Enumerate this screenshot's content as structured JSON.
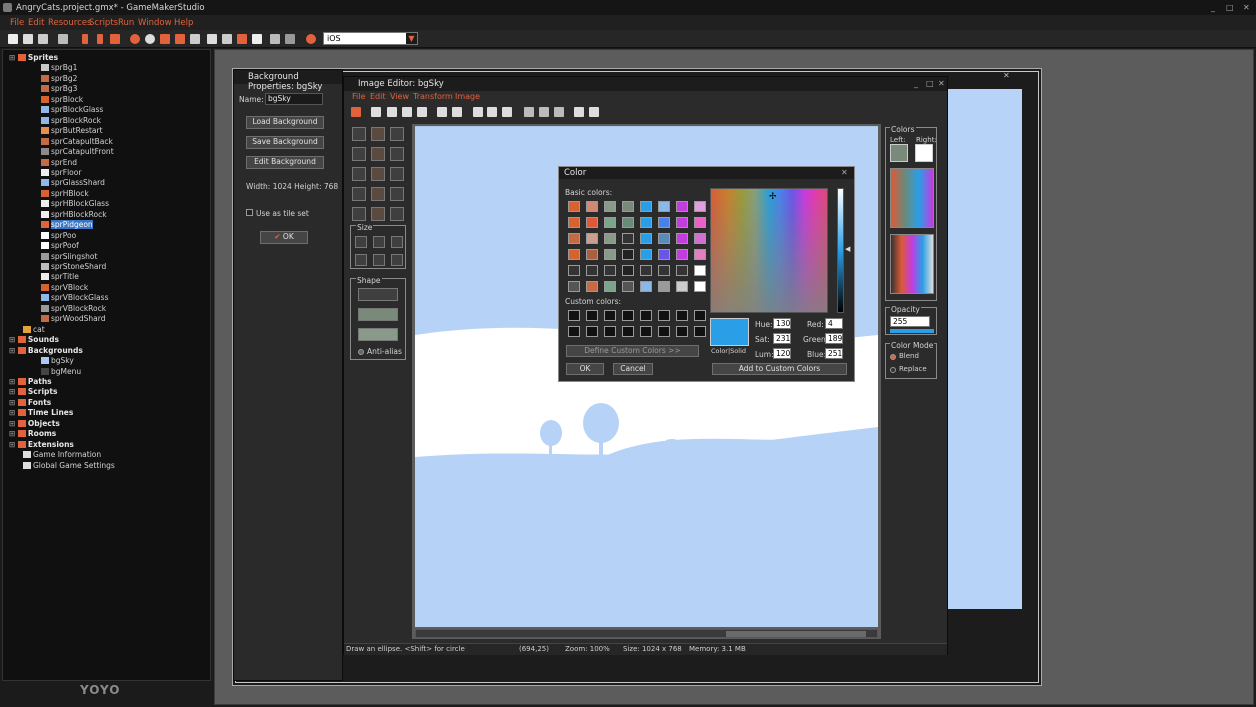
{
  "app": {
    "title": "AngryCats.project.gmx* - GameMakerStudio"
  },
  "menu": [
    "File",
    "Edit",
    "Resources",
    "Scripts",
    "Run",
    "Window",
    "Help"
  ],
  "toolbar": {
    "target": "iOS"
  },
  "tree": {
    "items": [
      {
        "label": "Sprites",
        "level": 0,
        "group": true
      },
      {
        "label": "sprBg1",
        "level": 2,
        "icon": "#c8c8c8"
      },
      {
        "label": "sprBg2",
        "level": 2,
        "icon": "#c46a44"
      },
      {
        "label": "sprBg3",
        "level": 2,
        "icon": "#c46a44"
      },
      {
        "label": "sprBlock",
        "level": 2,
        "icon": "#d5622f"
      },
      {
        "label": "sprBlockGlass",
        "level": 2,
        "icon": "#8fb8e8"
      },
      {
        "label": "sprBlockRock",
        "level": 2,
        "icon": "#8fb8e8"
      },
      {
        "label": "sprButRestart",
        "level": 2,
        "icon": "#e09050"
      },
      {
        "label": "sprCatapultBack",
        "level": 2,
        "icon": "#c46a44"
      },
      {
        "label": "sprCatapultFront",
        "level": 2,
        "icon": "#8a8a8a"
      },
      {
        "label": "sprEnd",
        "level": 2,
        "icon": "#c46a44"
      },
      {
        "label": "sprFloor",
        "level": 2,
        "icon": "#eeeeee"
      },
      {
        "label": "sprGlassShard",
        "level": 2,
        "icon": "#8fb8e8"
      },
      {
        "label": "sprHBlock",
        "level": 2,
        "icon": "#d5622f"
      },
      {
        "label": "sprHBlockGlass",
        "level": 2,
        "icon": "#eeeeee"
      },
      {
        "label": "sprHBlockRock",
        "level": 2,
        "icon": "#eeeeee"
      },
      {
        "label": "sprPidgeon",
        "level": 2,
        "icon": "#e2623c",
        "selected": true
      },
      {
        "label": "sprPoo",
        "level": 2,
        "icon": "#ffffff"
      },
      {
        "label": "sprPoof",
        "level": 2,
        "icon": "#ffffff"
      },
      {
        "label": "sprSlingshot",
        "level": 2,
        "icon": "#9a9a9a"
      },
      {
        "label": "sprStoneShard",
        "level": 2,
        "icon": "#bdbdbd"
      },
      {
        "label": "sprTitle",
        "level": 2,
        "icon": "#eeeeee"
      },
      {
        "label": "sprVBlock",
        "level": 2,
        "icon": "#d5622f"
      },
      {
        "label": "sprVBlockGlass",
        "level": 2,
        "icon": "#8fb8e8"
      },
      {
        "label": "sprVBlockRock",
        "level": 2,
        "icon": "#9a9a9a"
      },
      {
        "label": "sprWoodShard",
        "level": 2,
        "icon": "#c46a44"
      },
      {
        "label": "cat",
        "level": 1,
        "icon": "#e2a23c"
      },
      {
        "label": "Sounds",
        "level": 0,
        "group": true
      },
      {
        "label": "Backgrounds",
        "level": 0,
        "group": true
      },
      {
        "label": "bgSky",
        "level": 2,
        "icon": "#a9c8f3"
      },
      {
        "label": "bgMenu",
        "level": 2,
        "icon": "#444444"
      },
      {
        "label": "Paths",
        "level": 0,
        "group": true
      },
      {
        "label": "Scripts",
        "level": 0,
        "group": true
      },
      {
        "label": "Fonts",
        "level": 0,
        "group": true
      },
      {
        "label": "Time Lines",
        "level": 0,
        "group": true
      },
      {
        "label": "Objects",
        "level": 0,
        "group": true
      },
      {
        "label": "Rooms",
        "level": 0,
        "group": true
      },
      {
        "label": "Extensions",
        "level": 0,
        "group": true
      },
      {
        "label": "Game Information",
        "level": 1,
        "icon": "#dddddd"
      },
      {
        "label": "Global Game Settings",
        "level": 1,
        "icon": "#dddddd"
      }
    ]
  },
  "footer_logo": "YOYO",
  "bg_props": {
    "title": "Background Properties: bgSky",
    "name_label": "Name:",
    "name_value": "bgSky",
    "load": "Load Background",
    "save": "Save Background",
    "edit": "Edit Background",
    "size_text": "Width: 1024 Height: 768",
    "tile_label": "Use as tile set",
    "ok": "OK"
  },
  "image_editor": {
    "title": "Image Editor: bgSky",
    "menu": [
      "File",
      "Edit",
      "View",
      "Transform",
      "Image"
    ],
    "size_label": "Size",
    "shape_label": "Shape",
    "antialias_label": "Anti-alias",
    "colors_label": "Colors",
    "left_label": "Left:",
    "right_label": "Right:",
    "opacity_label": "Opacity",
    "opacity_value": "255",
    "color_mode_label": "Color Mode",
    "blend_label": "Blend",
    "replace_label": "Replace",
    "status": {
      "hint": "Draw an ellipse. <Shift> for circle",
      "coords": "(694,25)",
      "zoom": "Zoom: 100%",
      "size": "Size: 1024 x 768",
      "memory": "Memory: 3.1 MB"
    }
  },
  "color_dialog": {
    "title": "Color",
    "basic_label": "Basic colors:",
    "custom_label": "Custom colors:",
    "define_btn": "Define Custom Colors >>",
    "ok": "OK",
    "cancel": "Cancel",
    "add_btn": "Add to Custom Colors",
    "colorsolid_label": "Color|Solid",
    "hue_label": "Hue:",
    "hue": "130",
    "sat_label": "Sat:",
    "sat": "231",
    "lum_label": "Lum:",
    "lum": "120",
    "red_label": "Red:",
    "red": "4",
    "green_label": "Green:",
    "green": "189",
    "blue_label": "Blue:",
    "blue": "251",
    "current_color": "#2a9ee7",
    "basic_colors": [
      "#d5622f",
      "#cf8a74",
      "#8a9a8a",
      "#7a8a7a",
      "#2a9ee7",
      "#8ab8e8",
      "#c23ce0",
      "#e0a0e0",
      "#d5622f",
      "#dc5a36",
      "#7aa58a",
      "#6a8a7a",
      "#2a9ee7",
      "#4a80ea",
      "#c23ce0",
      "#e860c8",
      "#c46a44",
      "#c8a090",
      "#8a9a8a",
      "#333333",
      "#2a9ee7",
      "#5a8ab8",
      "#c23ce0",
      "#d070d0",
      "#d5622f",
      "#aa6040",
      "#8a9a8a",
      "#222222",
      "#2a9ee7",
      "#6a55e9",
      "#c23ce0",
      "#e080c0",
      "#333333",
      "#333333",
      "#333333",
      "#222222",
      "#333333",
      "#333333",
      "#333333",
      "#ffffff",
      "#555555",
      "#c46a44",
      "#7aa58a",
      "#555555",
      "#8ab8e8",
      "#9a9a9a",
      "#cccccc",
      "#ffffff"
    ]
  }
}
